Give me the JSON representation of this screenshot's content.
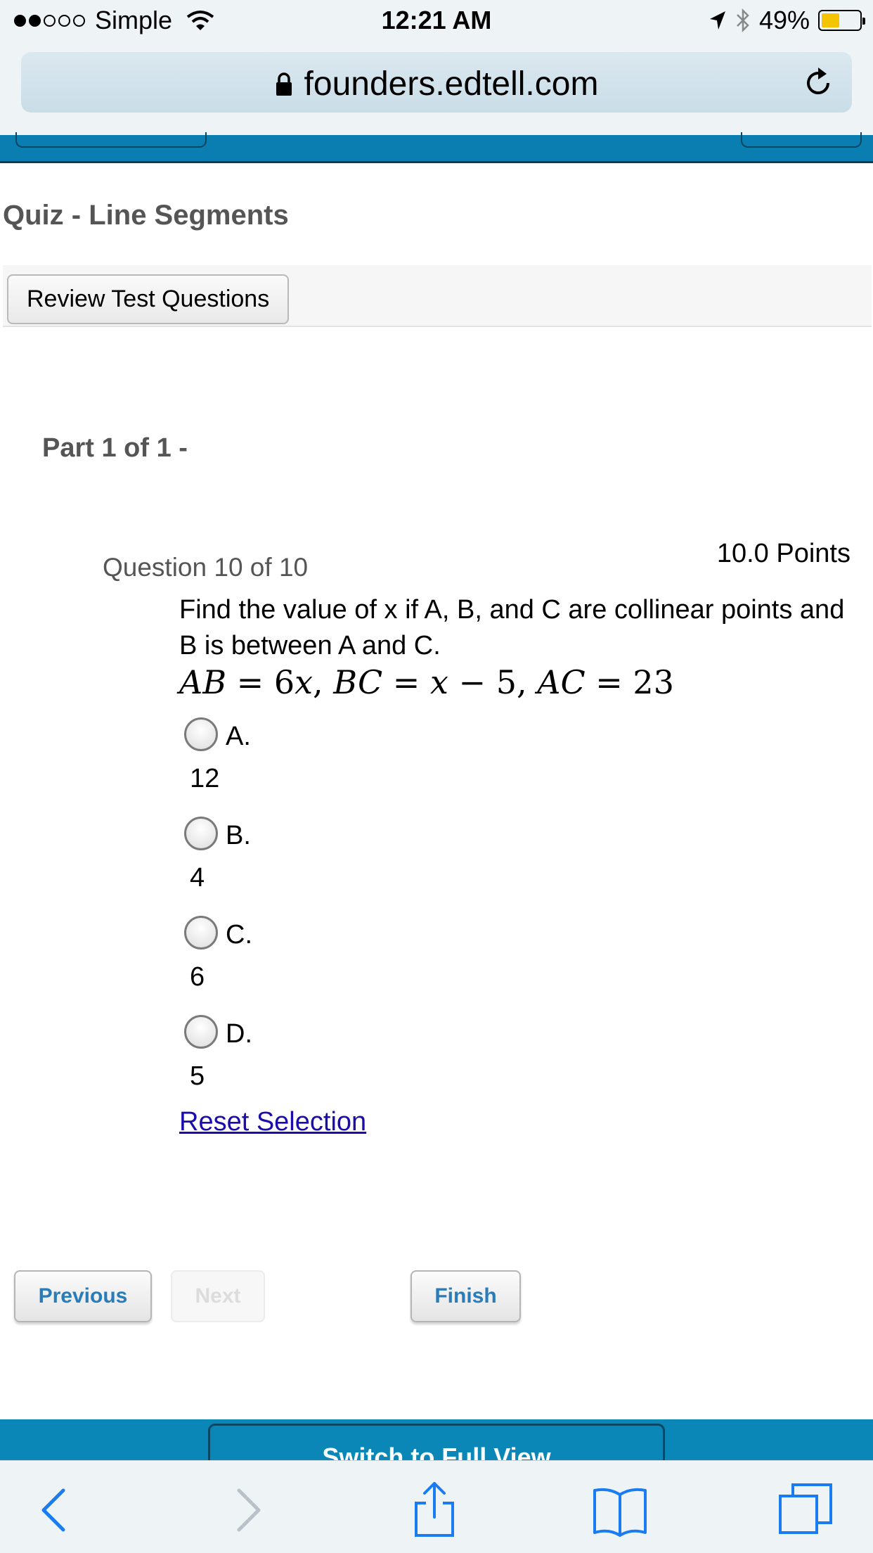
{
  "status_bar": {
    "carrier": "Simple",
    "time": "12:21 AM",
    "battery": "49%",
    "battery_level": 0.49
  },
  "browser": {
    "url": "founders.edtell.com"
  },
  "page": {
    "title": "Quiz - Line Segments",
    "review_button": "Review Test Questions",
    "part_label": "Part 1 of 1 -"
  },
  "question": {
    "number": "Question 10 of 10",
    "points": "10.0 Points",
    "text": "Find the value of x if A, B, and C are collinear points and B is between A and C.",
    "equation": "AB = 6x, BC = x − 5, AC = 23",
    "options": [
      {
        "letter": "A.",
        "value": "12"
      },
      {
        "letter": "B.",
        "value": "4"
      },
      {
        "letter": "C.",
        "value": "6"
      },
      {
        "letter": "D.",
        "value": "5"
      }
    ],
    "reset_label": "Reset Selection"
  },
  "navigation": {
    "previous": "Previous",
    "next": "Next",
    "finish": "Finish"
  },
  "footer": {
    "full_view": "Switch to Full View"
  },
  "colors": {
    "accent_blue": "#0a86b7",
    "button_text": "#2a7cb8",
    "link": "#1a0dab"
  }
}
